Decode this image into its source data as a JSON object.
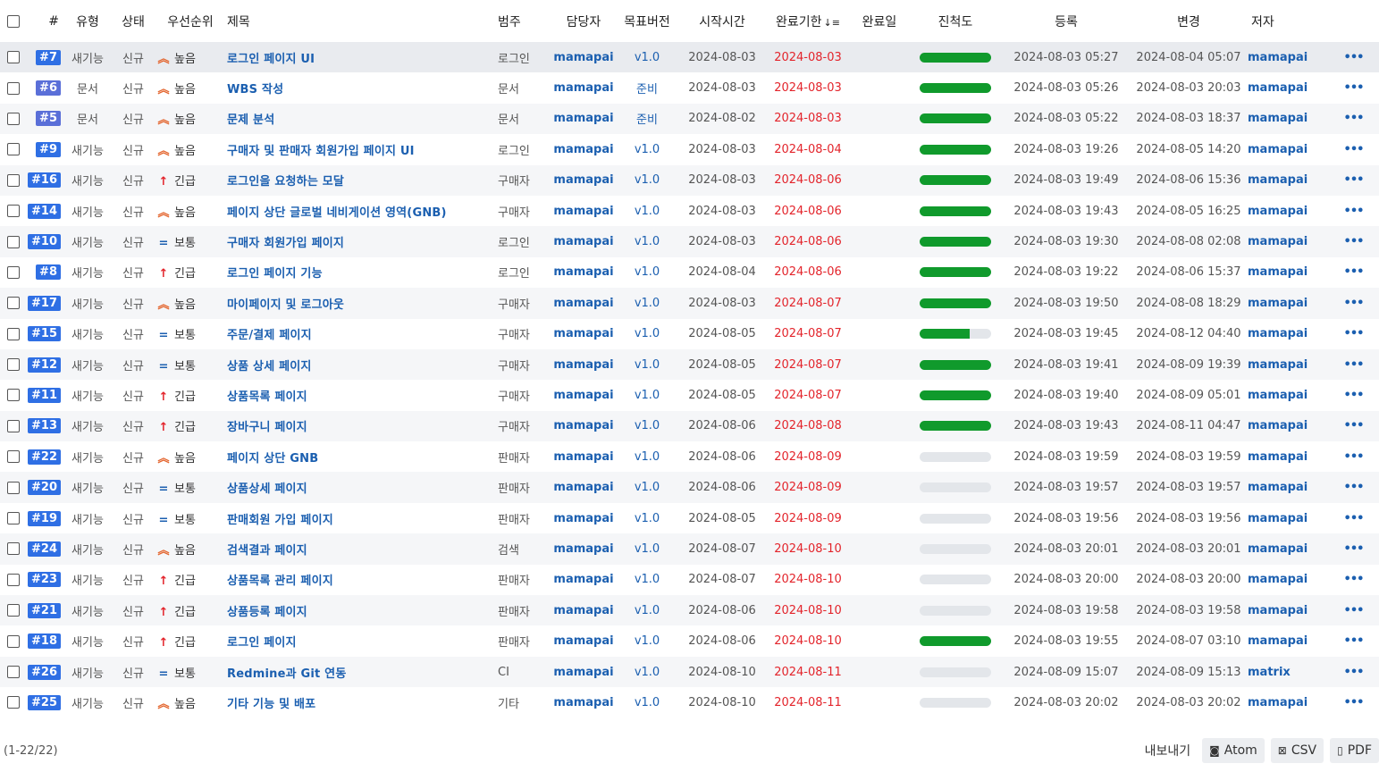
{
  "header": {
    "hash": "#",
    "type": "유형",
    "status": "상태",
    "priority": "우선순위",
    "title": "제목",
    "category": "범주",
    "assignee": "담당자",
    "version": "목표버전",
    "start": "시작시간",
    "due": "완료기한",
    "done": "완료일",
    "progress": "진척도",
    "created": "등록",
    "updated": "변경",
    "author": "저자"
  },
  "colors": {
    "accent": "#1b5fb0",
    "due": "#e3242b",
    "progress": "#109a2c",
    "feature_badge": "#2f6fe4",
    "doc_badge": "#5a6fd8"
  },
  "rows": [
    {
      "id": "#7",
      "type": "새기능",
      "status": "신규",
      "priority": "높음",
      "pri_icon": "chevron-double-up-icon",
      "title": "로그인 페이지 UI",
      "category": "로그인",
      "assignee": "mamapai",
      "version": "v1.0",
      "start": "2024-08-03",
      "due": "2024-08-03",
      "done": "",
      "progress": 1,
      "created": "2024-08-03 05:27",
      "updated": "2024-08-04 05:07",
      "author": "mamapai"
    },
    {
      "id": "#6",
      "type": "문서",
      "status": "신규",
      "priority": "높음",
      "pri_icon": "chevron-double-up-icon",
      "title": "WBS 작성",
      "category": "문서",
      "assignee": "mamapai",
      "version": "준비",
      "start": "2024-08-03",
      "due": "2024-08-03",
      "done": "",
      "progress": 1,
      "created": "2024-08-03 05:26",
      "updated": "2024-08-03 20:03",
      "author": "mamapai"
    },
    {
      "id": "#5",
      "type": "문서",
      "status": "신규",
      "priority": "높음",
      "pri_icon": "chevron-double-up-icon",
      "title": "문제 분석",
      "category": "문서",
      "assignee": "mamapai",
      "version": "준비",
      "start": "2024-08-02",
      "due": "2024-08-03",
      "done": "",
      "progress": 1,
      "created": "2024-08-03 05:22",
      "updated": "2024-08-03 18:37",
      "author": "mamapai"
    },
    {
      "id": "#9",
      "type": "새기능",
      "status": "신규",
      "priority": "높음",
      "pri_icon": "chevron-double-up-icon",
      "title": "구매자 및 판매자 회원가입 페이지 UI",
      "category": "로그인",
      "assignee": "mamapai",
      "version": "v1.0",
      "start": "2024-08-03",
      "due": "2024-08-04",
      "done": "",
      "progress": 1,
      "created": "2024-08-03 19:26",
      "updated": "2024-08-05 14:20",
      "author": "mamapai"
    },
    {
      "id": "#16",
      "type": "새기능",
      "status": "신규",
      "priority": "긴급",
      "pri_icon": "arrow-up-icon",
      "title": "로그인을 요청하는 모달",
      "category": "구매자",
      "assignee": "mamapai",
      "version": "v1.0",
      "start": "2024-08-03",
      "due": "2024-08-06",
      "done": "",
      "progress": 1,
      "created": "2024-08-03 19:49",
      "updated": "2024-08-06 15:36",
      "author": "mamapai"
    },
    {
      "id": "#14",
      "type": "새기능",
      "status": "신규",
      "priority": "높음",
      "pri_icon": "chevron-double-up-icon",
      "title": "페이지 상단 글로벌 네비게이션 영역(GNB)",
      "category": "구매자",
      "assignee": "mamapai",
      "version": "v1.0",
      "start": "2024-08-03",
      "due": "2024-08-06",
      "done": "",
      "progress": 1,
      "created": "2024-08-03 19:43",
      "updated": "2024-08-05 16:25",
      "author": "mamapai"
    },
    {
      "id": "#10",
      "type": "새기능",
      "status": "신규",
      "priority": "보통",
      "pri_icon": "equals-icon",
      "title": "구매자 회원가입 페이지",
      "category": "로그인",
      "assignee": "mamapai",
      "version": "v1.0",
      "start": "2024-08-03",
      "due": "2024-08-06",
      "done": "",
      "progress": 1,
      "created": "2024-08-03 19:30",
      "updated": "2024-08-08 02:08",
      "author": "mamapai"
    },
    {
      "id": "#8",
      "type": "새기능",
      "status": "신규",
      "priority": "긴급",
      "pri_icon": "arrow-up-icon",
      "title": "로그인 페이지 기능",
      "category": "로그인",
      "assignee": "mamapai",
      "version": "v1.0",
      "start": "2024-08-04",
      "due": "2024-08-06",
      "done": "",
      "progress": 1,
      "created": "2024-08-03 19:22",
      "updated": "2024-08-06 15:37",
      "author": "mamapai"
    },
    {
      "id": "#17",
      "type": "새기능",
      "status": "신규",
      "priority": "높음",
      "pri_icon": "chevron-double-up-icon",
      "title": "마이페이지 및 로그아웃",
      "category": "구매자",
      "assignee": "mamapai",
      "version": "v1.0",
      "start": "2024-08-03",
      "due": "2024-08-07",
      "done": "",
      "progress": 1,
      "created": "2024-08-03 19:50",
      "updated": "2024-08-08 18:29",
      "author": "mamapai"
    },
    {
      "id": "#15",
      "type": "새기능",
      "status": "신규",
      "priority": "보통",
      "pri_icon": "equals-icon",
      "title": "주문/결제 페이지",
      "category": "구매자",
      "assignee": "mamapai",
      "version": "v1.0",
      "start": "2024-08-05",
      "due": "2024-08-07",
      "done": "",
      "progress": 0.7,
      "created": "2024-08-03 19:45",
      "updated": "2024-08-12 04:40",
      "author": "mamapai"
    },
    {
      "id": "#12",
      "type": "새기능",
      "status": "신규",
      "priority": "보통",
      "pri_icon": "equals-icon",
      "title": "상품 상세 페이지",
      "category": "구매자",
      "assignee": "mamapai",
      "version": "v1.0",
      "start": "2024-08-05",
      "due": "2024-08-07",
      "done": "",
      "progress": 1,
      "created": "2024-08-03 19:41",
      "updated": "2024-08-09 19:39",
      "author": "mamapai"
    },
    {
      "id": "#11",
      "type": "새기능",
      "status": "신규",
      "priority": "긴급",
      "pri_icon": "arrow-up-icon",
      "title": "상품목록 페이지",
      "category": "구매자",
      "assignee": "mamapai",
      "version": "v1.0",
      "start": "2024-08-05",
      "due": "2024-08-07",
      "done": "",
      "progress": 1,
      "created": "2024-08-03 19:40",
      "updated": "2024-08-09 05:01",
      "author": "mamapai"
    },
    {
      "id": "#13",
      "type": "새기능",
      "status": "신규",
      "priority": "긴급",
      "pri_icon": "arrow-up-icon",
      "title": "장바구니 페이지",
      "category": "구매자",
      "assignee": "mamapai",
      "version": "v1.0",
      "start": "2024-08-06",
      "due": "2024-08-08",
      "done": "",
      "progress": 1,
      "created": "2024-08-03 19:43",
      "updated": "2024-08-11 04:47",
      "author": "mamapai"
    },
    {
      "id": "#22",
      "type": "새기능",
      "status": "신규",
      "priority": "높음",
      "pri_icon": "chevron-double-up-icon",
      "title": "페이지 상단 GNB",
      "category": "판매자",
      "assignee": "mamapai",
      "version": "v1.0",
      "start": "2024-08-06",
      "due": "2024-08-09",
      "done": "",
      "progress": 0,
      "created": "2024-08-03 19:59",
      "updated": "2024-08-03 19:59",
      "author": "mamapai"
    },
    {
      "id": "#20",
      "type": "새기능",
      "status": "신규",
      "priority": "보통",
      "pri_icon": "equals-icon",
      "title": "상품상세 페이지",
      "category": "판매자",
      "assignee": "mamapai",
      "version": "v1.0",
      "start": "2024-08-06",
      "due": "2024-08-09",
      "done": "",
      "progress": 0,
      "created": "2024-08-03 19:57",
      "updated": "2024-08-03 19:57",
      "author": "mamapai"
    },
    {
      "id": "#19",
      "type": "새기능",
      "status": "신규",
      "priority": "보통",
      "pri_icon": "equals-icon",
      "title": "판매회원 가입 페이지",
      "category": "판매자",
      "assignee": "mamapai",
      "version": "v1.0",
      "start": "2024-08-05",
      "due": "2024-08-09",
      "done": "",
      "progress": 0,
      "created": "2024-08-03 19:56",
      "updated": "2024-08-03 19:56",
      "author": "mamapai"
    },
    {
      "id": "#24",
      "type": "새기능",
      "status": "신규",
      "priority": "높음",
      "pri_icon": "chevron-double-up-icon",
      "title": "검색결과 페이지",
      "category": "검색",
      "assignee": "mamapai",
      "version": "v1.0",
      "start": "2024-08-07",
      "due": "2024-08-10",
      "done": "",
      "progress": 0,
      "created": "2024-08-03 20:01",
      "updated": "2024-08-03 20:01",
      "author": "mamapai"
    },
    {
      "id": "#23",
      "type": "새기능",
      "status": "신규",
      "priority": "긴급",
      "pri_icon": "arrow-up-icon",
      "title": "상품목록 관리 페이지",
      "category": "판매자",
      "assignee": "mamapai",
      "version": "v1.0",
      "start": "2024-08-07",
      "due": "2024-08-10",
      "done": "",
      "progress": 0,
      "created": "2024-08-03 20:00",
      "updated": "2024-08-03 20:00",
      "author": "mamapai"
    },
    {
      "id": "#21",
      "type": "새기능",
      "status": "신규",
      "priority": "긴급",
      "pri_icon": "arrow-up-icon",
      "title": "상품등록 페이지",
      "category": "판매자",
      "assignee": "mamapai",
      "version": "v1.0",
      "start": "2024-08-06",
      "due": "2024-08-10",
      "done": "",
      "progress": 0,
      "created": "2024-08-03 19:58",
      "updated": "2024-08-03 19:58",
      "author": "mamapai"
    },
    {
      "id": "#18",
      "type": "새기능",
      "status": "신규",
      "priority": "긴급",
      "pri_icon": "arrow-up-icon",
      "title": "로그인 페이지",
      "category": "판매자",
      "assignee": "mamapai",
      "version": "v1.0",
      "start": "2024-08-06",
      "due": "2024-08-10",
      "done": "",
      "progress": 1,
      "created": "2024-08-03 19:55",
      "updated": "2024-08-07 03:10",
      "author": "mamapai"
    },
    {
      "id": "#26",
      "type": "새기능",
      "status": "신규",
      "priority": "보통",
      "pri_icon": "equals-icon",
      "title": "Redmine과 Git 연동",
      "category": "CI",
      "assignee": "mamapai",
      "version": "v1.0",
      "start": "2024-08-10",
      "due": "2024-08-11",
      "done": "",
      "progress": 0,
      "created": "2024-08-09 15:07",
      "updated": "2024-08-09 15:13",
      "author": "matrix"
    },
    {
      "id": "#25",
      "type": "새기능",
      "status": "신규",
      "priority": "높음",
      "pri_icon": "chevron-double-up-icon",
      "title": "기타 기능 및 배포",
      "category": "기타",
      "assignee": "mamapai",
      "version": "v1.0",
      "start": "2024-08-10",
      "due": "2024-08-11",
      "done": "",
      "progress": 0,
      "created": "2024-08-03 20:02",
      "updated": "2024-08-03 20:02",
      "author": "mamapai"
    }
  ],
  "footer": {
    "count": "(1-22/22)",
    "export_label": "내보내기",
    "atom": "Atom",
    "csv": "CSV",
    "pdf": "PDF"
  }
}
